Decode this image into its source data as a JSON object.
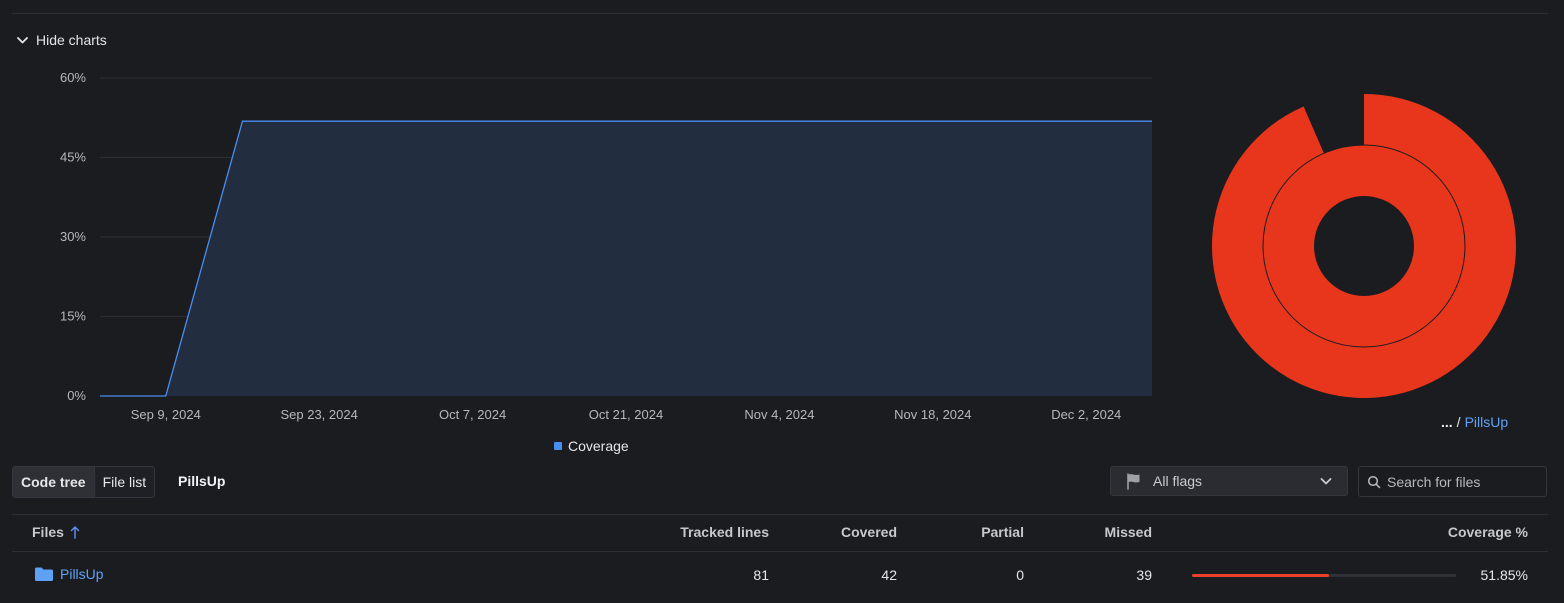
{
  "toolbar": {
    "hide_charts_label": "Hide charts"
  },
  "chart_data": {
    "type": "area",
    "x": [
      "Sep 3, 2024",
      "Sep 9, 2024",
      "Sep 16, 2024",
      "Dec 2, 2024",
      "Dec 8, 2024"
    ],
    "series": [
      {
        "name": "Coverage",
        "values": [
          0,
          0,
          51.85,
          51.85,
          51.85
        ]
      }
    ],
    "x_tick_labels": [
      "Sep 9, 2024",
      "Sep 23, 2024",
      "Oct 7, 2024",
      "Oct 21, 2024",
      "Nov 4, 2024",
      "Nov 18, 2024",
      "Dec 2, 2024"
    ],
    "y_tick_labels": [
      "0%",
      "15%",
      "30%",
      "45%",
      "60%"
    ],
    "ylim": [
      0,
      60
    ],
    "grid": true,
    "legend": "bottom",
    "color": "#4a8df0"
  },
  "legend": {
    "label": "Coverage"
  },
  "sunburst": {
    "coverage_percent": 51.85,
    "color": "#e8361c",
    "hole_color": "#1b1c20"
  },
  "breadcrumb": {
    "ellipsis": "...",
    "separator": "/",
    "current": "PillsUp"
  },
  "view_toggle": {
    "code_tree": "Code tree",
    "file_list": "File list",
    "active": "Code tree"
  },
  "current_dir": "PillsUp",
  "flags": {
    "label": "All flags"
  },
  "search": {
    "placeholder": "Search for files",
    "value": ""
  },
  "table": {
    "headers": {
      "files": "Files",
      "tracked": "Tracked lines",
      "covered": "Covered",
      "partial": "Partial",
      "missed": "Missed",
      "coverage": "Coverage %"
    },
    "rows": [
      {
        "name": "PillsUp",
        "tracked": "81",
        "covered": "42",
        "partial": "0",
        "missed": "39",
        "coverage": "51.85%",
        "coverage_fraction": 0.5185
      }
    ]
  },
  "colors": {
    "accent": "#5ea2f5",
    "danger": "#e8402c",
    "background": "#1b1c20"
  }
}
